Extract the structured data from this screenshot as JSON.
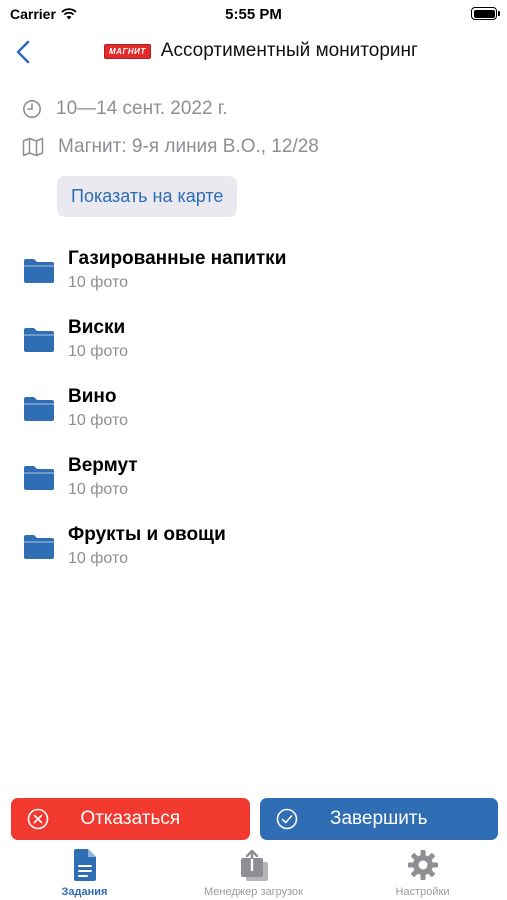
{
  "status_bar": {
    "carrier": "Carrier",
    "time": "5:55 PM"
  },
  "nav": {
    "logo_text": "МАГНИТ",
    "title": "Ассортиментный мониторинг"
  },
  "task": {
    "date_range": "10—14 сент. 2022 г.",
    "address": "Магнит: 9-я линия В.О., 12/28",
    "map_button_label": "Показать на карте"
  },
  "folders": [
    {
      "name": "Газированные напитки",
      "count": "10 фото"
    },
    {
      "name": "Виски",
      "count": "10 фото"
    },
    {
      "name": "Вино",
      "count": "10 фото"
    },
    {
      "name": "Вермут",
      "count": "10 фото"
    },
    {
      "name": "Фрукты и овощи",
      "count": "10 фото"
    }
  ],
  "actions": {
    "decline_label": "Отказаться",
    "finish_label": "Завершить"
  },
  "tabs": [
    {
      "label": "Задания",
      "icon": "document-icon",
      "active": true
    },
    {
      "label": "Менеджер загрузок",
      "icon": "upload-stack-icon",
      "active": false
    },
    {
      "label": "Настройки",
      "icon": "gear-icon",
      "active": false
    }
  ],
  "colors": {
    "accent": "#2f6db5",
    "decline": "#f2392f",
    "secondary_text": "#8e8e93",
    "logo_red": "#e42b2b"
  }
}
